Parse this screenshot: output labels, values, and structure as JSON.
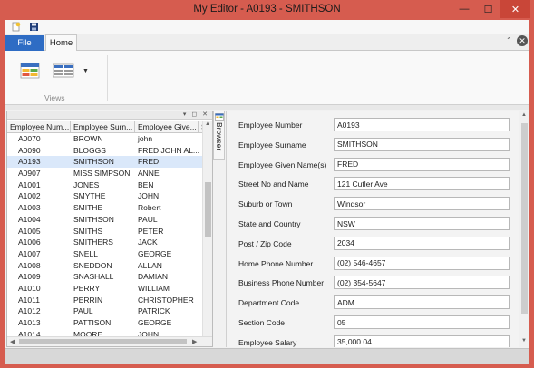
{
  "window": {
    "title": "My Editor - A0193 - SMITHSON",
    "min_glyph": "—",
    "max_glyph": "☐",
    "close_glyph": "✕",
    "accent_color": "#d65c4f"
  },
  "qat": {
    "new_icon": "new-document-icon",
    "save_icon": "save-icon"
  },
  "ribbon": {
    "file_tab": "File",
    "home_tab": "Home",
    "collapse_glyph": "⌃",
    "close_glyph": "✕",
    "group_label": "Views",
    "dropdown_glyph": "▼",
    "button1_icon": "grid-view-icon",
    "button2_icon": "list-view-icon"
  },
  "pane": {
    "buttons": "▾ ◻ ✕"
  },
  "grid": {
    "columns": [
      "Employee Num...",
      "Employee Surn...",
      "Employee Give...",
      "St"
    ],
    "rows": [
      [
        "A0070",
        "BROWN",
        "john",
        ""
      ],
      [
        "A0090",
        "BLOGGS",
        "FRED JOHN AL...",
        ""
      ],
      [
        "A0193",
        "SMITHSON",
        "FRED",
        ""
      ],
      [
        "A0907",
        "MISS SIMPSON",
        "ANNE",
        ""
      ],
      [
        "A1001",
        "JONES",
        "BEN",
        ""
      ],
      [
        "A1002",
        "SMYTHE",
        "JOHN",
        ""
      ],
      [
        "A1003",
        "SMITHE",
        "Robert",
        ""
      ],
      [
        "A1004",
        "SMITHSON",
        "PAUL",
        ""
      ],
      [
        "A1005",
        "SMITHS",
        "PETER",
        ""
      ],
      [
        "A1006",
        "SMITHERS",
        "JACK",
        ""
      ],
      [
        "A1007",
        "SNELL",
        "GEORGE",
        ""
      ],
      [
        "A1008",
        "SNEDDON",
        "ALLAN",
        ""
      ],
      [
        "A1009",
        "SNASHALL",
        "DAMIAN",
        ""
      ],
      [
        "A1010",
        "PERRY",
        "WILLIAM",
        ""
      ],
      [
        "A1011",
        "PERRIN",
        "CHRISTOPHER",
        ""
      ],
      [
        "A1012",
        "PAUL",
        "PATRICK",
        ""
      ],
      [
        "A1013",
        "PATTISON",
        "GEORGE",
        ""
      ],
      [
        "A1014",
        "MOORE",
        "JOHN",
        ""
      ]
    ],
    "selected_index": 2,
    "selection_color": "#dae8fa"
  },
  "scroll": {
    "up": "▲",
    "down": "▼",
    "left": "◀",
    "right": "▶"
  },
  "browser": {
    "label": "Browser",
    "icon": "browser-icon"
  },
  "form": {
    "fields": [
      {
        "label": "Employee Number",
        "value": "A0193"
      },
      {
        "label": "Employee Surname",
        "value": "SMITHSON"
      },
      {
        "label": "Employee Given Name(s)",
        "value": "FRED"
      },
      {
        "label": "Street No and Name",
        "value": "121 Cutler Ave"
      },
      {
        "label": "Suburb or Town",
        "value": "Windsor"
      },
      {
        "label": "State and Country",
        "value": "NSW"
      },
      {
        "label": "Post / Zip Code",
        "value": "2034"
      },
      {
        "label": "Home Phone Number",
        "value": "(02) 546-4657"
      },
      {
        "label": "Business Phone Number",
        "value": "(02) 354-5647"
      },
      {
        "label": "Department Code",
        "value": "ADM"
      },
      {
        "label": "Section Code",
        "value": "05"
      },
      {
        "label": "Employee Salary",
        "value": "35,000.04"
      }
    ]
  }
}
